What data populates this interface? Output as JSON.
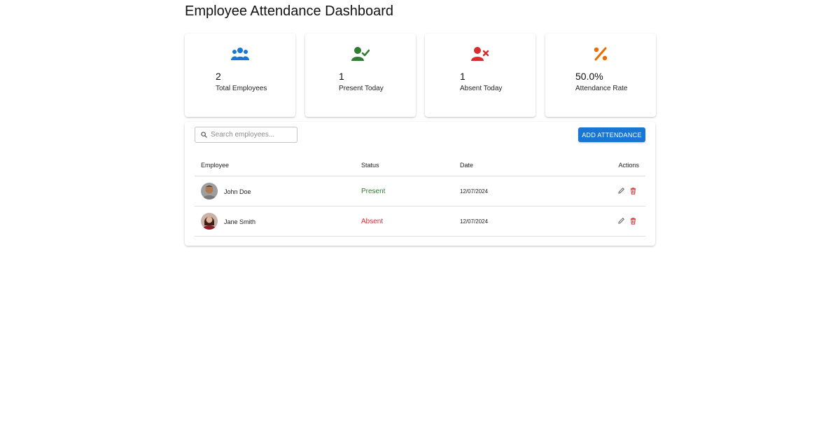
{
  "page": {
    "title": "Employee Attendance Dashboard"
  },
  "stats": [
    {
      "value": "2",
      "label": "Total Employees",
      "icon": "users-icon",
      "color": "#1976d2"
    },
    {
      "value": "1",
      "label": "Present Today",
      "icon": "user-check-icon",
      "color": "#2e7d32"
    },
    {
      "value": "1",
      "label": "Absent Today",
      "icon": "user-x-icon",
      "color": "#d32f2f"
    },
    {
      "value": "50.0%",
      "label": "Attendance Rate",
      "icon": "percent-icon",
      "color": "#ed6c02"
    }
  ],
  "search": {
    "placeholder": "Search employees...",
    "value": ""
  },
  "toolbar": {
    "add_label": "ADD ATTENDANCE",
    "accent": "#1976d2"
  },
  "table": {
    "headers": {
      "employee": "Employee",
      "status": "Status",
      "date": "Date",
      "actions": "Actions"
    },
    "rows": [
      {
        "name": "John Doe",
        "status": "Present",
        "status_color": "#2e7d32",
        "date": "12/07/2024"
      },
      {
        "name": "Jane Smith",
        "status": "Absent",
        "status_color": "#d32f2f",
        "date": "12/07/2024"
      }
    ]
  }
}
